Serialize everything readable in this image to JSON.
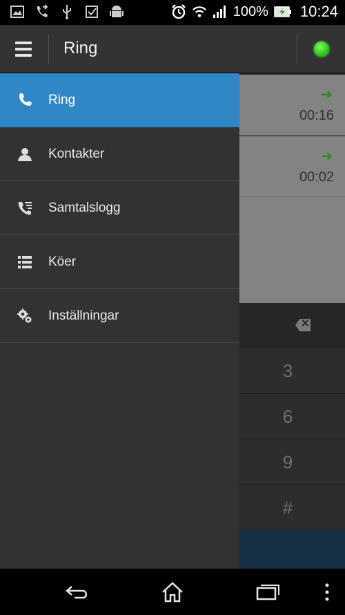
{
  "status_bar": {
    "icons": [
      "picture-icon",
      "call-forward-icon",
      "usb-icon",
      "checkbox-icon",
      "android-icon"
    ],
    "right_icons": [
      "alarm-icon",
      "wifi-icon",
      "signal-icon",
      "battery-icon"
    ],
    "battery": "100%",
    "time": "10:24"
  },
  "app_bar": {
    "title": "Ring",
    "status_color": "#2fcc1c"
  },
  "drawer": {
    "items": [
      {
        "label": "Ring",
        "icon": "phone-icon",
        "active": true
      },
      {
        "label": "Kontakter",
        "icon": "person-icon",
        "active": false
      },
      {
        "label": "Samtalslogg",
        "icon": "call-log-icon",
        "active": false
      },
      {
        "label": "Köer",
        "icon": "list-icon",
        "active": false
      },
      {
        "label": "Inställningar",
        "icon": "gears-icon",
        "active": false
      }
    ]
  },
  "calls": [
    {
      "direction": "outgoing",
      "duration": "00:16"
    },
    {
      "direction": "outgoing",
      "duration": "00:02"
    }
  ],
  "keypad": {
    "keys": [
      "3",
      "6",
      "9",
      "#"
    ]
  },
  "nav_bar": {
    "buttons": [
      "back-icon",
      "home-icon",
      "recents-icon",
      "overflow-icon"
    ]
  },
  "colors": {
    "accent": "#3087c6",
    "drawer_bg": "#323232",
    "outgoing_arrow": "#2e8a22"
  }
}
